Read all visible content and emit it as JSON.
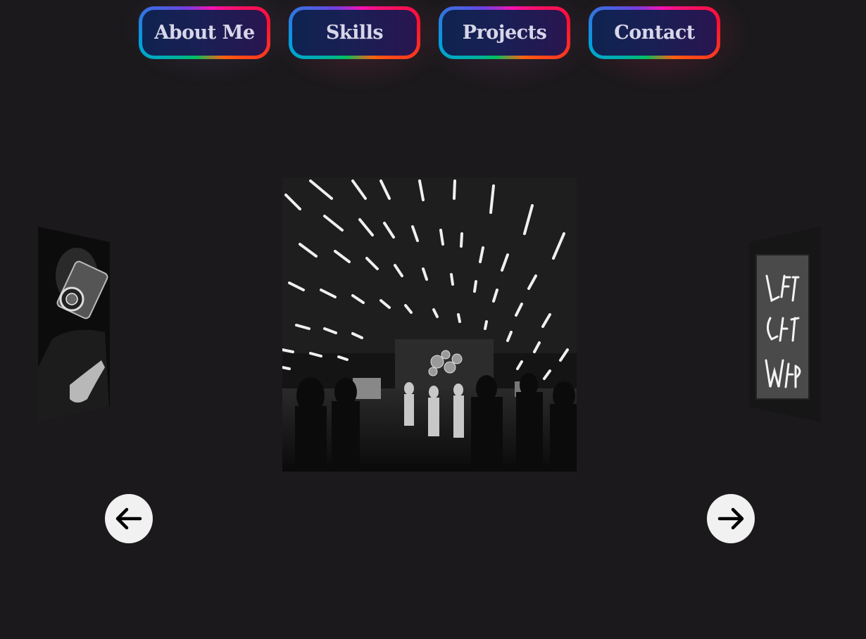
{
  "nav": {
    "items": [
      {
        "label": "About Me"
      },
      {
        "label": "Skills"
      },
      {
        "label": "Projects"
      },
      {
        "label": "Contact"
      }
    ]
  },
  "carousel": {
    "slides": [
      {
        "subject": "camera-photographer-photo"
      },
      {
        "subject": "nightclub-party-photo"
      },
      {
        "subject": "neon-sign-photo"
      }
    ],
    "prev_icon": "arrow-left-icon",
    "next_icon": "arrow-right-icon"
  },
  "colors": {
    "background": "#1b191c",
    "button_fill": "#14204f",
    "button_text": "#d8d6ea",
    "arrow_button": "#f1f1f1"
  }
}
